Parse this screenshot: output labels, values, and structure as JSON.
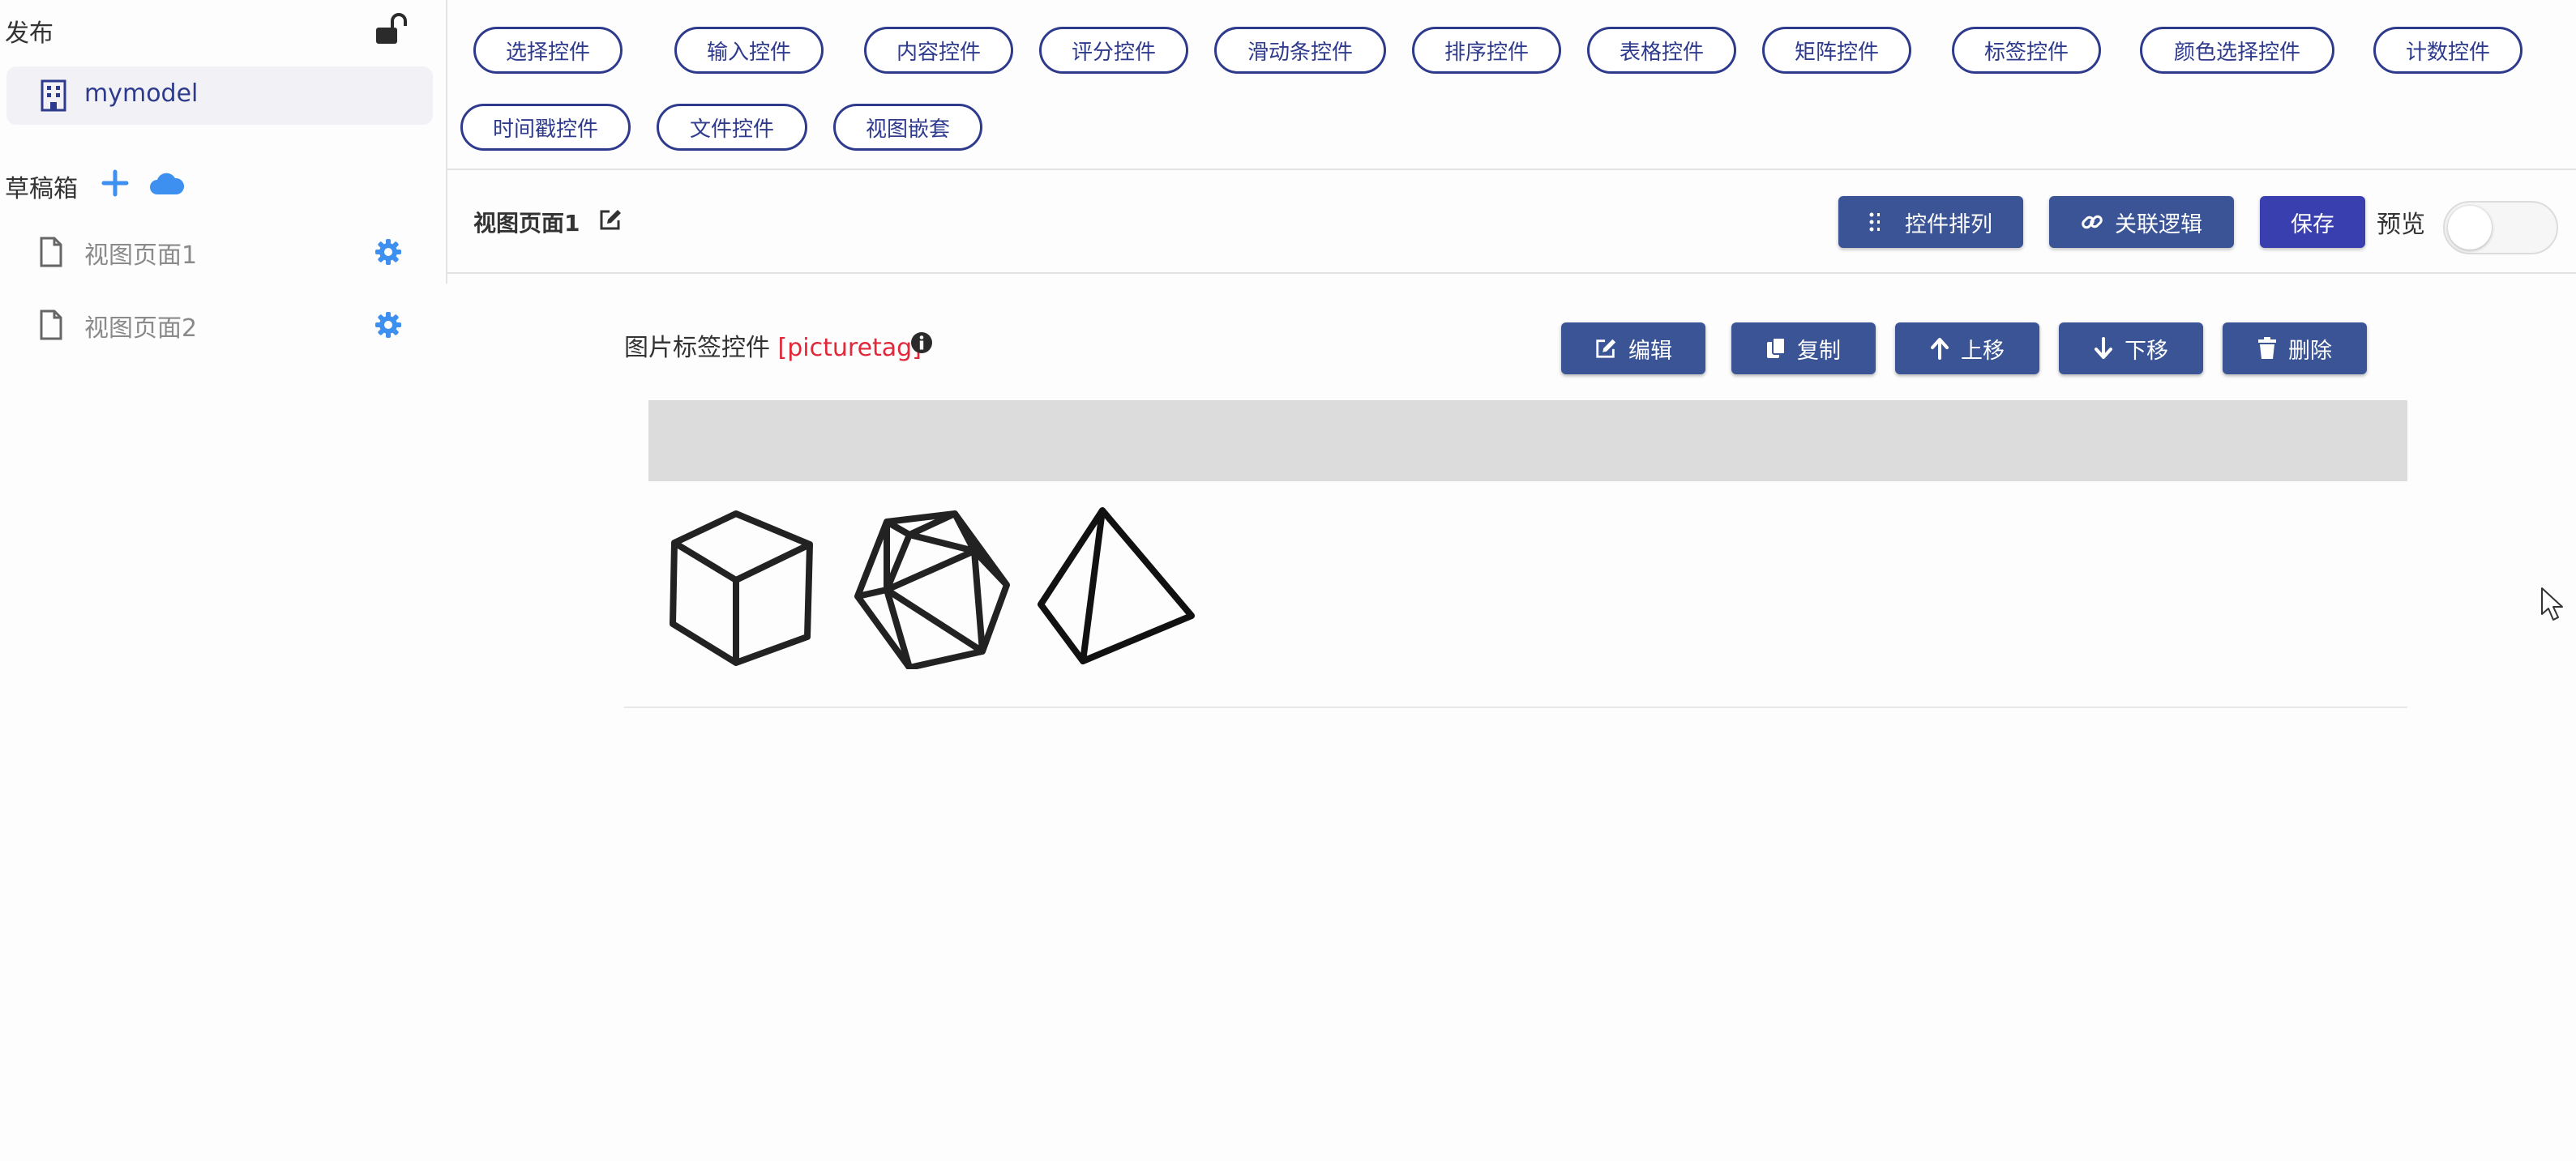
{
  "sidebar": {
    "publish_title": "发布",
    "model_name": "mymodel",
    "draft_title": "草稿箱",
    "pages": [
      {
        "label": "视图页面1"
      },
      {
        "label": "视图页面2"
      }
    ]
  },
  "toolbar": {
    "chips": [
      "选择控件",
      "输入控件",
      "内容控件",
      "评分控件",
      "滑动条控件",
      "排序控件",
      "表格控件",
      "矩阵控件",
      "标签控件",
      "颜色选择控件",
      "计数控件",
      "时间戳控件",
      "文件控件",
      "视图嵌套"
    ]
  },
  "header": {
    "page_title": "视图页面1",
    "arrange_label": "控件排列",
    "logic_label": "关联逻辑",
    "save_label": "保存",
    "preview_label": "预览",
    "preview_on": false
  },
  "control": {
    "label": "图片标签控件",
    "tag": "[picturetag]",
    "actions": {
      "edit": "编辑",
      "copy": "复制",
      "up": "上移",
      "down": "下移",
      "delete": "删除"
    }
  },
  "icons": [
    "lock-open-icon",
    "building-icon",
    "plus-icon",
    "cloud-icon",
    "file-icon",
    "gear-icon",
    "edit-icon",
    "list-icon",
    "link-icon",
    "info-icon",
    "copy-icon",
    "arrow-up-icon",
    "arrow-down-icon",
    "trash-icon",
    "cube-icon",
    "icosahedron-icon",
    "tetrahedron-icon",
    "cursor-icon"
  ],
  "colors": {
    "primary": "#3b5495",
    "save": "#3a3fb0",
    "chip_border": "#2e3a8c",
    "tag_red": "#e0283a",
    "icon_blue": "#3d8ff0"
  }
}
